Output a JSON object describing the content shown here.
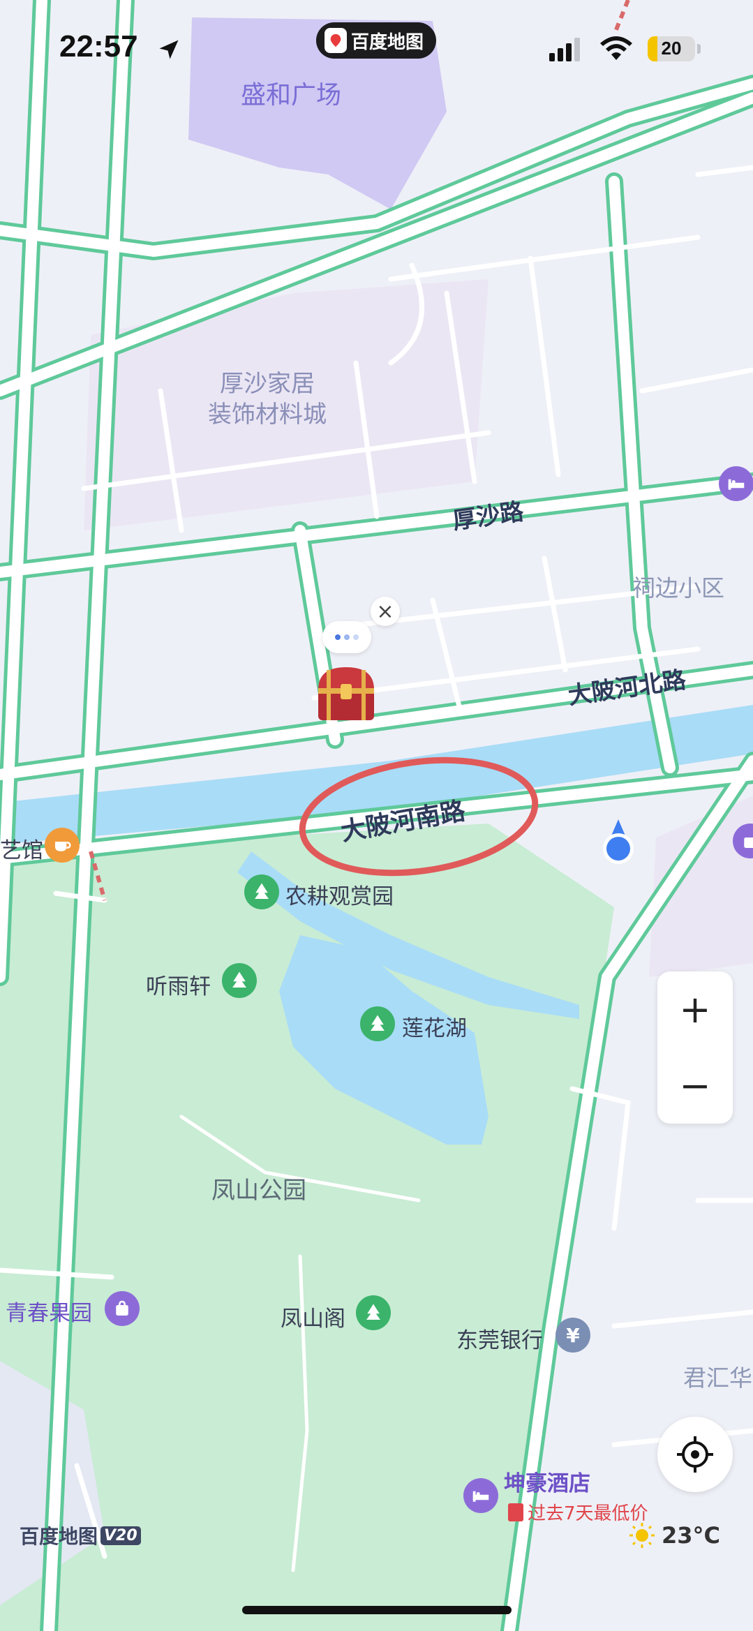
{
  "status_bar": {
    "time": "22:57",
    "app_badge": "百度地图",
    "battery": "20"
  },
  "map": {
    "areas": {
      "plaza": "盛和广场",
      "furniture_line1": "厚沙家居",
      "furniture_line2": "装饰材料城",
      "community": "祠边小区",
      "park": "凤山公园",
      "junhui": "君汇华"
    },
    "roads": {
      "housha": "厚沙路",
      "river_north": "大陂河北路",
      "river_south": "大陂河南路"
    },
    "pois": {
      "art_hall": "艺馆",
      "farm_view": "农耕观赏园",
      "tingyu": "听雨轩",
      "lotus_lake": "莲花湖",
      "youth_orchard": "青春果园",
      "fengshan_pavilion": "凤山阁",
      "dongguan_bank": "东莞银行",
      "hotel": "坤豪酒店",
      "hotel_promo": "过去7天最低价"
    }
  },
  "controls": {
    "zoom_in": "+",
    "zoom_out": "−",
    "close_bubble": "×"
  },
  "footer": {
    "brand": "百度地图",
    "version": "V20",
    "temperature": "23°C"
  },
  "colors": {
    "road_outline": "#5fc99a",
    "water": "#a9dcf7",
    "park": "#c9ecd4",
    "annotation": "#e05a5a",
    "poi_green": "#3bb36b",
    "poi_purple": "#8c6bd9",
    "poi_orange": "#f09a3a",
    "location_blue": "#3f7ef0"
  },
  "icons": [
    "location-arrow-icon",
    "signal-icon",
    "wifi-icon",
    "battery-icon",
    "treasure-chest-icon",
    "tree-icon",
    "bag-icon",
    "hotel-bed-icon",
    "bank-yen-icon",
    "coffee-icon",
    "locate-crosshair-icon",
    "sun-icon"
  ]
}
